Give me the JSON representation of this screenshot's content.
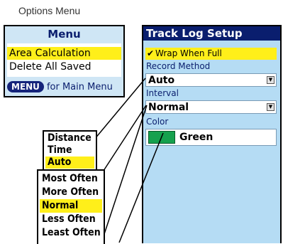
{
  "caption": "Options Menu",
  "options_menu": {
    "title": "Menu",
    "items": [
      "Area Calculation",
      "Delete All Saved"
    ],
    "footer_key": "MENU",
    "footer_text": "for Main Menu"
  },
  "track_log": {
    "title": "Track Log Setup",
    "wrap_label": "Wrap When Full",
    "wrap_checked": true,
    "record_method_label": "Record Method",
    "record_method_value": "Auto",
    "interval_label": "Interval",
    "interval_value": "Normal",
    "color_label": "Color",
    "color_value": "Green",
    "color_hex": "#16a14e"
  },
  "record_method_options": [
    "Distance",
    "Time",
    "Auto"
  ],
  "interval_options": [
    "Most Often",
    "More Often",
    "Normal",
    "Less Often",
    "Least Often"
  ],
  "highlight_color": "#ffef1a"
}
